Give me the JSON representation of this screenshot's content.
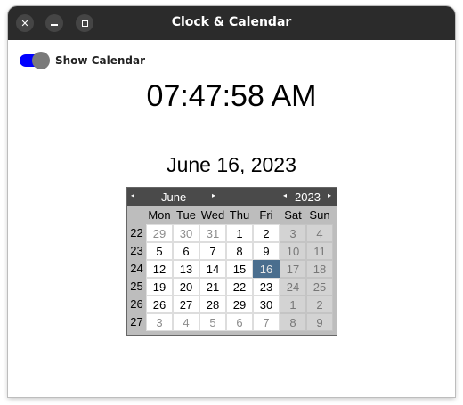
{
  "window": {
    "title": "Clock & Calendar",
    "close_glyph": "✕"
  },
  "toggle": {
    "label": "Show Calendar",
    "on": true,
    "accent": "#0000ff"
  },
  "clock": {
    "time": "07:47:58 AM"
  },
  "date": {
    "text": "June 16, 2023"
  },
  "calendar": {
    "month": "June",
    "year": "2023",
    "prev_month_glyph": "◂",
    "next_month_glyph": "▸",
    "prev_year_glyph": "◂",
    "next_year_glyph": "▸",
    "weekday_headers": [
      "Mon",
      "Tue",
      "Wed",
      "Thu",
      "Fri",
      "Sat",
      "Sun"
    ],
    "weeks": [
      {
        "week": "22",
        "days": [
          "29",
          "30",
          "31",
          "1",
          "2",
          "3",
          "4"
        ]
      },
      {
        "week": "23",
        "days": [
          "5",
          "6",
          "7",
          "8",
          "9",
          "10",
          "11"
        ]
      },
      {
        "week": "24",
        "days": [
          "12",
          "13",
          "14",
          "15",
          "16",
          "17",
          "18"
        ]
      },
      {
        "week": "25",
        "days": [
          "19",
          "20",
          "21",
          "22",
          "23",
          "24",
          "25"
        ]
      },
      {
        "week": "26",
        "days": [
          "26",
          "27",
          "28",
          "29",
          "30",
          "1",
          "2"
        ]
      },
      {
        "week": "27",
        "days": [
          "3",
          "4",
          "5",
          "6",
          "7",
          "8",
          "9"
        ]
      }
    ],
    "selected_day": "16",
    "selected_color": "#4a6e8e"
  }
}
